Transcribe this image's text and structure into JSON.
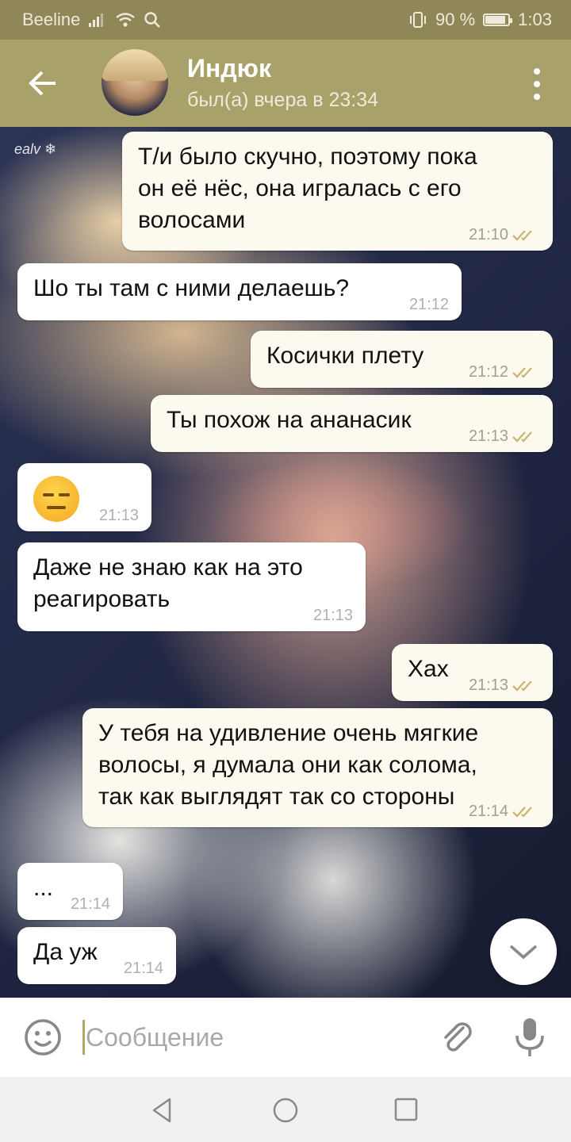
{
  "status_bar": {
    "carrier": "Beeline",
    "battery_percent": "90 %",
    "battery_level": 0.9,
    "time": "1:03"
  },
  "header": {
    "contact_name": "Индюк",
    "last_seen": "был(а) вчера в 23:34"
  },
  "chat": {
    "watermark": "ealv ❄",
    "messages": [
      {
        "direction": "out",
        "text": [
          "Т/и было скучно, поэтому пока",
          "он её нёс, она игралась с его",
          "волосами"
        ],
        "time": "21:10",
        "read": true
      },
      {
        "direction": "in",
        "text": [
          "Шо ты там с ними делаешь?"
        ],
        "time": "21:12"
      },
      {
        "direction": "out",
        "text": [
          "Косички плету"
        ],
        "time": "21:12",
        "read": true
      },
      {
        "direction": "out",
        "text": [
          "Ты похож на ананасик"
        ],
        "time": "21:13",
        "read": true
      },
      {
        "direction": "in",
        "emoji": "expressionless-face",
        "time": "21:13"
      },
      {
        "direction": "in",
        "text": [
          "Даже не знаю как на это",
          "реагировать"
        ],
        "time": "21:13"
      },
      {
        "direction": "out",
        "text": [
          "Хах"
        ],
        "time": "21:13",
        "read": true
      },
      {
        "direction": "out",
        "text": [
          "У тебя на удивление очень мягкие",
          "волосы, я думала они как солома,",
          "так как выглядят так со стороны"
        ],
        "time": "21:14",
        "read": true
      },
      {
        "direction": "in",
        "text": [
          "..."
        ],
        "time": "21:14"
      },
      {
        "direction": "in",
        "text": [
          "Да уж"
        ],
        "time": "21:14"
      }
    ]
  },
  "composer": {
    "placeholder": "Сообщение"
  },
  "icons": {
    "back": "arrow-left-icon",
    "menu": "more-vertical-icon",
    "scroll_down": "chevron-down-icon",
    "emoji": "smiley-icon",
    "attach": "paperclip-icon",
    "mic": "microphone-icon"
  },
  "colors": {
    "header_bg": "#a9a16a",
    "status_bg": "#8f8758",
    "out_bubble": "#fcf9ee",
    "in_bubble": "#ffffff",
    "accent": "#b3a85b"
  }
}
